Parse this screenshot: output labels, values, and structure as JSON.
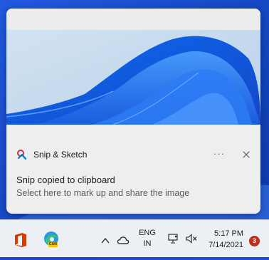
{
  "toast": {
    "app_name": "Snip & Sketch",
    "more_label": "···",
    "title": "Snip copied to clipboard",
    "subtitle": "Select here to mark up and share the image"
  },
  "taskbar": {
    "edge_badge": "CAN",
    "lang_line1": "ENG",
    "lang_line2": "IN",
    "time": "5:17 PM",
    "date": "7/14/2021",
    "notification_count": "3"
  },
  "colors": {
    "accent": "#1a4fd6",
    "badge": "#c42b1c",
    "office": "#d83b01"
  }
}
